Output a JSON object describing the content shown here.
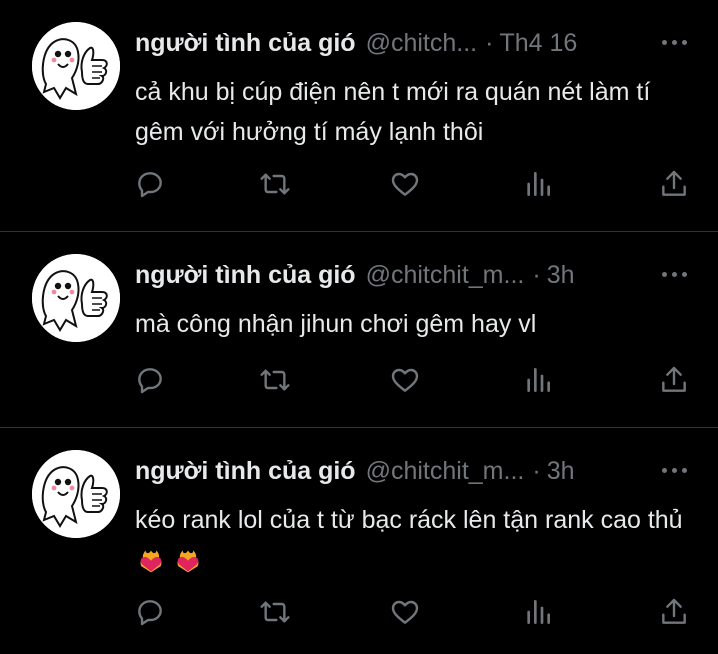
{
  "tweets": [
    {
      "display_name": "người tình của gió",
      "handle": "@chitch...",
      "separator": "·",
      "time": "Th4 16",
      "text": "cả khu bị cúp điện nên t mới ra quán nét làm tí gêm với hưởng tí máy lạnh thôi",
      "emoji": ""
    },
    {
      "display_name": "người tình của gió",
      "handle": "@chitchit_m...",
      "separator": "·",
      "time": "3h",
      "text": "mà công nhận jihun chơi gêm hay vl",
      "emoji": ""
    },
    {
      "display_name": "người tình của gió",
      "handle": "@chitchit_m...",
      "separator": "·",
      "time": "3h",
      "text": "kéo rank lol của t từ bạc ráck lên tận rank cao thủ",
      "emoji": "heart-on-fire x2"
    }
  ],
  "icons": {
    "reply": "reply-icon",
    "retweet": "retweet-icon",
    "like": "like-icon",
    "views": "views-icon",
    "share": "share-icon",
    "more": "more-icon"
  },
  "colors": {
    "background": "#000000",
    "text": "#e7e9ea",
    "muted": "#71767b",
    "divider": "#2f3336"
  }
}
